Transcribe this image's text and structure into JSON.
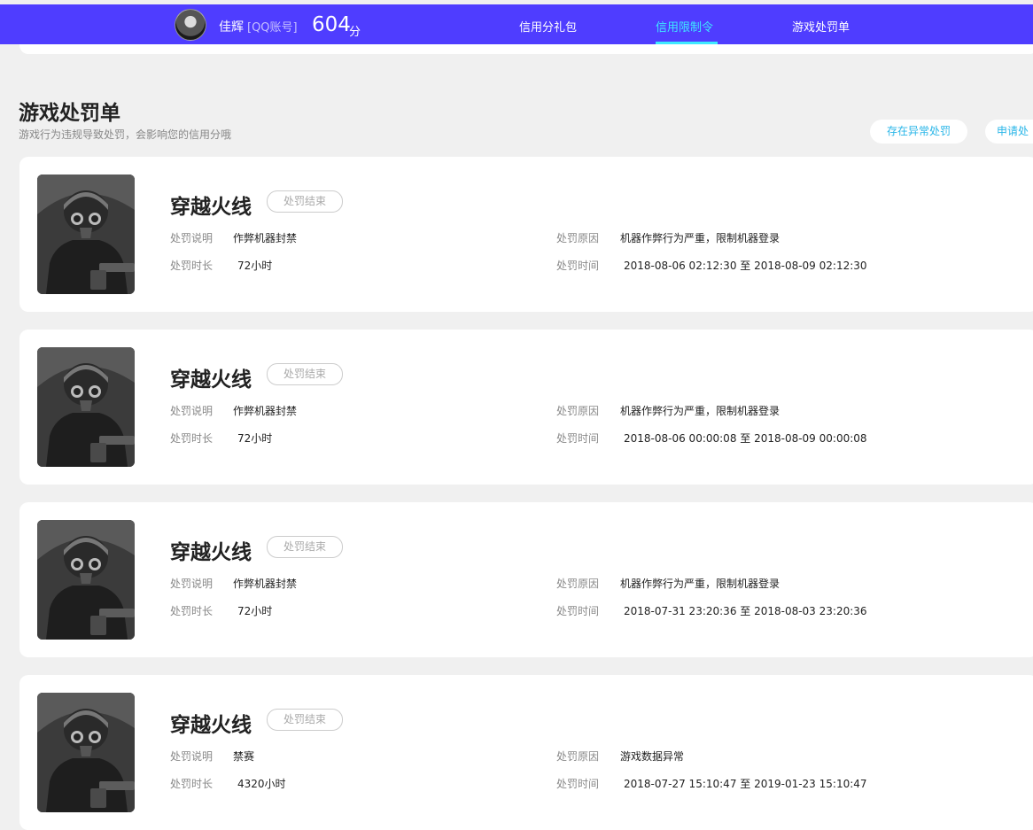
{
  "header": {
    "username": "佳辉",
    "account_type": "[QQ账号]",
    "score": "604",
    "score_unit": "分",
    "nav": [
      {
        "label": "信用分礼包",
        "active": false
      },
      {
        "label": "信用限制令",
        "active": true
      },
      {
        "label": "游戏处罚单",
        "active": false
      }
    ]
  },
  "section": {
    "title": "游戏处罚单",
    "description": "游戏行为违规导致处罚，会影响您的信用分哦",
    "actions": [
      "存在异常处罚",
      "申请处"
    ]
  },
  "field_labels": {
    "description": "处罚说明",
    "duration": "处罚时长",
    "reason": "处罚原因",
    "time": "处罚时间"
  },
  "colors": {
    "brand": "#4f3dff",
    "nav_active": "#3ee9ff",
    "action_text": "#29b6e8"
  },
  "records": [
    {
      "game": "穿越火线",
      "status": "处罚结束",
      "description": "作弊机器封禁",
      "duration": "72小时",
      "reason": "机器作弊行为严重，限制机器登录",
      "time": "2018-08-06 02:12:30 至 2018-08-09 02:12:30"
    },
    {
      "game": "穿越火线",
      "status": "处罚结束",
      "description": "作弊机器封禁",
      "duration": "72小时",
      "reason": "机器作弊行为严重，限制机器登录",
      "time": "2018-08-06 00:00:08 至 2018-08-09 00:00:08"
    },
    {
      "game": "穿越火线",
      "status": "处罚结束",
      "description": "作弊机器封禁",
      "duration": "72小时",
      "reason": "机器作弊行为严重，限制机器登录",
      "time": "2018-07-31 23:20:36 至 2018-08-03 23:20:36"
    },
    {
      "game": "穿越火线",
      "status": "处罚结束",
      "description": "禁赛",
      "duration": "4320小时",
      "reason": "游戏数据异常",
      "time": "2018-07-27 15:10:47 至 2019-01-23 15:10:47"
    }
  ]
}
